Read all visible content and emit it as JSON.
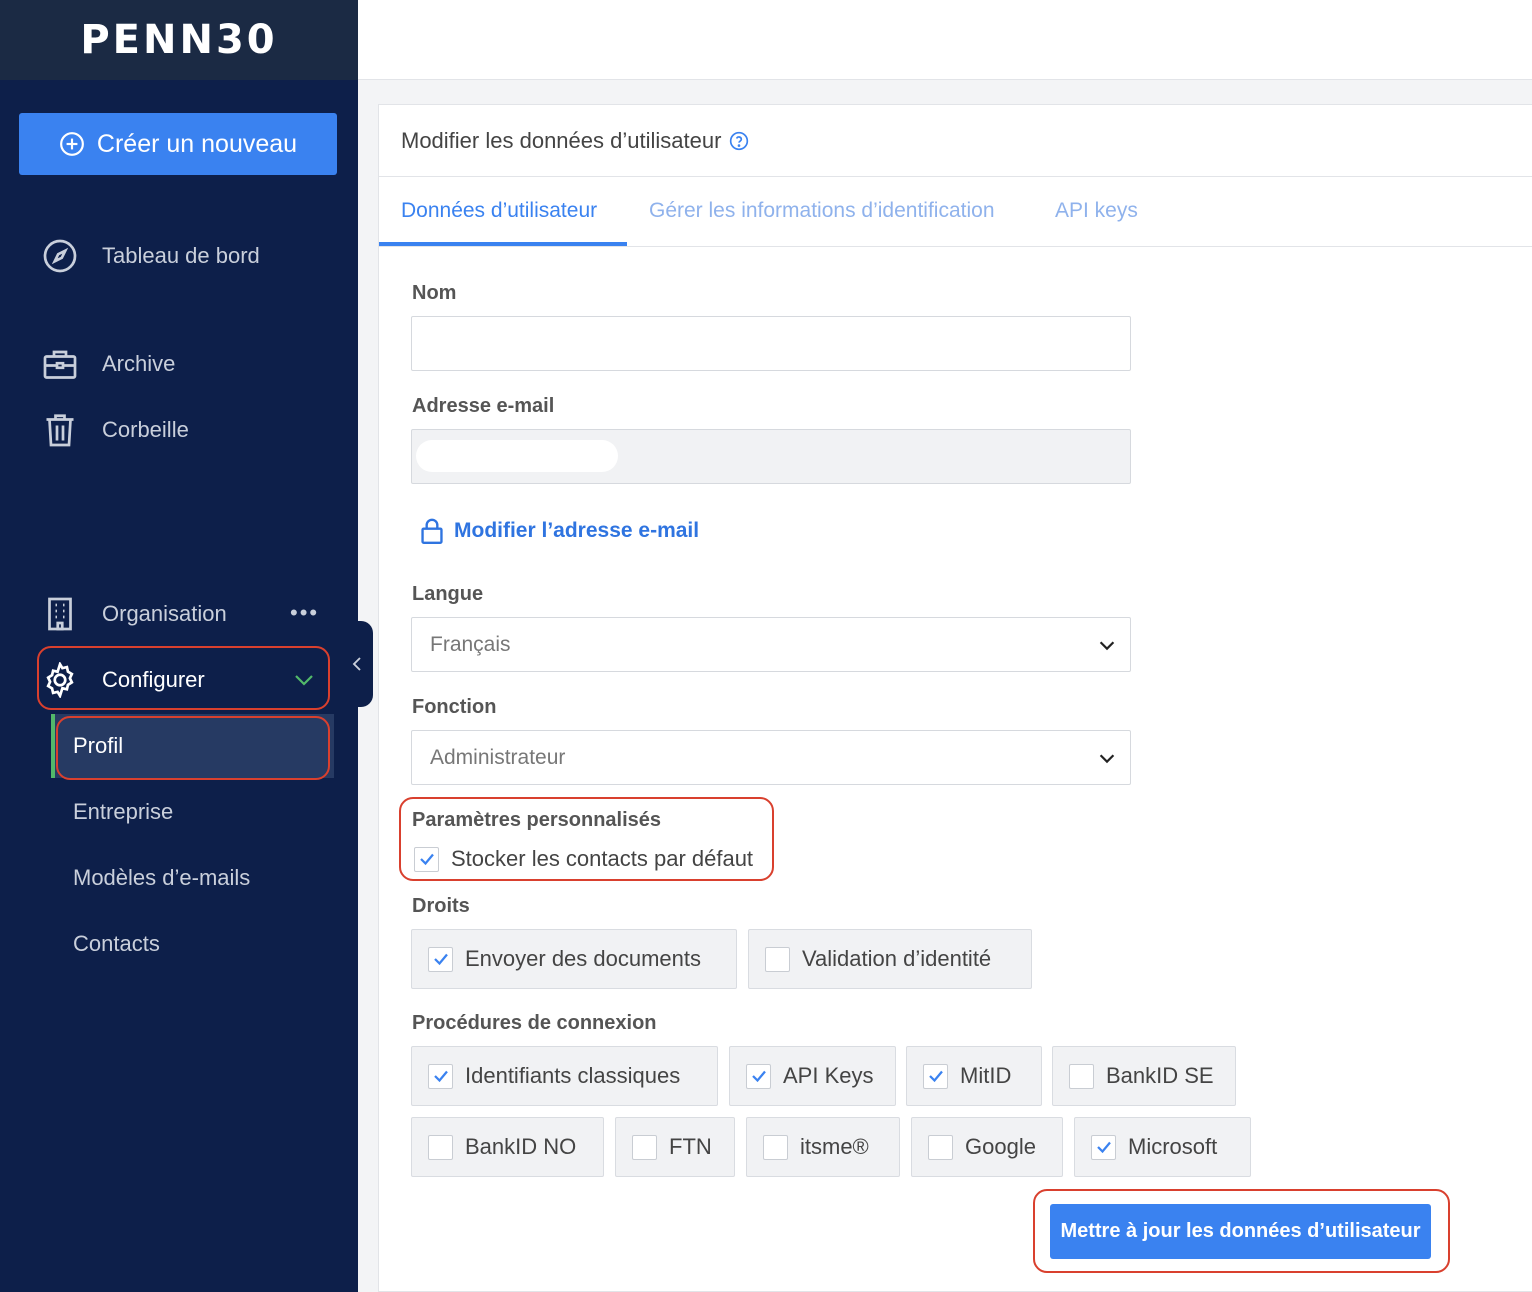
{
  "sidebar": {
    "logo": "PENN30",
    "create_label": "Créer un nouveau",
    "items": {
      "dashboard": "Tableau de bord",
      "archive": "Archive",
      "trash": "Corbeille",
      "organisation": "Organisation",
      "configure": "Configurer"
    },
    "more": "•••",
    "subitems": {
      "profile": "Profil",
      "company": "Entreprise",
      "email_templates": "Modèles d’e-mails",
      "contacts": "Contacts"
    }
  },
  "card": {
    "title": "Modifier les données d’utilisateur",
    "tabs": {
      "user_data": "Données d’utilisateur",
      "credentials": "Gérer les informations d’identification",
      "api_keys": "API keys"
    }
  },
  "form": {
    "name_label": "Nom",
    "name_value": "",
    "email_label": "Adresse e-mail",
    "change_email_link": "Modifier l’adresse e-mail",
    "language_label": "Langue",
    "language_value": "Français",
    "role_label": "Fonction",
    "role_value": "Administrateur",
    "custom_label": "Paramètres personnalisés",
    "store_contacts": "Stocker les contacts par défaut",
    "rights_label": "Droits",
    "rights": {
      "send_docs": "Envoyer des documents",
      "id_validation": "Validation d’identité"
    },
    "login_label": "Procédures de connexion",
    "login": {
      "classic": "Identifiants classiques",
      "api_keys": "API Keys",
      "mitid": "MitID",
      "bankid_se": "BankID SE",
      "bankid_no": "BankID NO",
      "ftn": "FTN",
      "itsme": "itsme®",
      "google": "Google",
      "microsoft": "Microsoft"
    },
    "submit_label": "Mettre à jour les données d’utilisateur"
  },
  "colors": {
    "sidebar_bg": "#0d1f4a",
    "accent": "#3a82f0",
    "highlight_outline": "#d9402e",
    "active_marker": "#52b96a"
  }
}
